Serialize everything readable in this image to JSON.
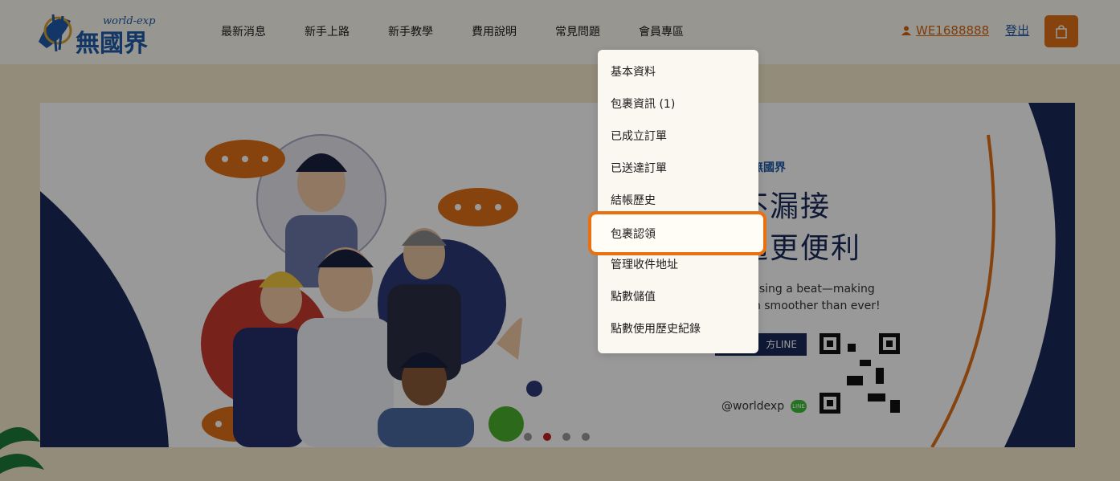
{
  "brand": {
    "logo_en": "world-exp",
    "logo_zh": "無國界"
  },
  "nav": {
    "items": [
      {
        "label": "最新消息"
      },
      {
        "label": "新手上路"
      },
      {
        "label": "新手教學"
      },
      {
        "label": "費用說明"
      },
      {
        "label": "常見問題"
      },
      {
        "label": "會員專區"
      }
    ]
  },
  "user": {
    "id": "WE1688888",
    "logout_label": "登出",
    "icon": "user-icon"
  },
  "cart": {
    "icon": "shopping-bag-icon"
  },
  "dropdown": {
    "items": [
      {
        "label": "基本資料"
      },
      {
        "label": "包裹資訊 (1)"
      },
      {
        "label": "已成立訂單"
      },
      {
        "label": "已送達訂單"
      },
      {
        "label": "結帳歷史"
      },
      {
        "label": "包裹認領"
      },
      {
        "label": "管理收件地址"
      },
      {
        "label": "點數儲值"
      },
      {
        "label": "點數使用歷史紀錄"
      }
    ],
    "highlighted_index": 5
  },
  "banner": {
    "brand_mini": "無國界",
    "headline_1": "不漏接",
    "headline_2": "通更便利",
    "sub_1": "missing a beat—making",
    "sub_2": "tion smoother than ever!",
    "line_label": "方LINE",
    "handle": "@worldexp",
    "line_badge": "LINE"
  },
  "carousel": {
    "count": 4,
    "active_index": 1
  },
  "colors": {
    "accent": "#e07016",
    "link": "#2257a8",
    "navy": "#1a2b5a"
  }
}
